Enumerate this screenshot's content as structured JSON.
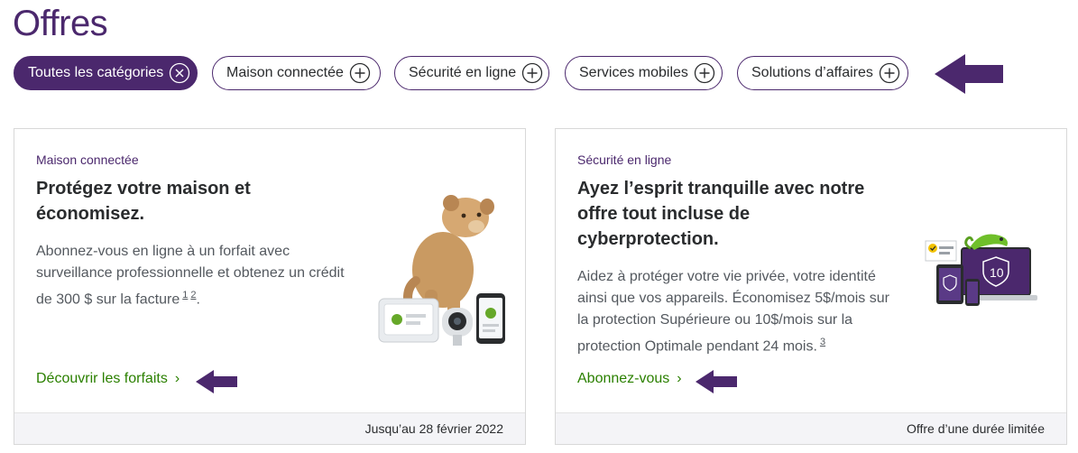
{
  "page": {
    "title": "Offres"
  },
  "filters": [
    {
      "label": "Toutes les catégories",
      "active": true,
      "icon": "close-circle-icon"
    },
    {
      "label": "Maison connectée",
      "active": false,
      "icon": "plus-circle-icon"
    },
    {
      "label": "Sécurité en ligne",
      "active": false,
      "icon": "plus-circle-icon"
    },
    {
      "label": "Services mobiles",
      "active": false,
      "icon": "plus-circle-icon"
    },
    {
      "label": "Solutions d’affaires",
      "active": false,
      "icon": "plus-circle-icon"
    }
  ],
  "cards": [
    {
      "category": "Maison connectée",
      "title_line1": "Protégez votre maison et",
      "title_line2": "économisez.",
      "text_line1": "Abonnez-vous en ligne à un forfait avec",
      "text_line2": "surveillance professionnelle et obtenez un crédit",
      "text_line3": "de 300 $ sur la facture",
      "footnote_a": "1",
      "footnote_b": "2",
      "text_end": ".",
      "link": "Découvrir les forfaits",
      "footer": "Jusqu’au 28 février 2022",
      "image": "lion-cub-smart-home-devices"
    },
    {
      "category": "Sécurité en ligne",
      "title_line1": "Ayez l’esprit tranquille avec notre",
      "title_line2": "offre tout incluse de",
      "title_line3": "cyberprotection.",
      "text_line1": "Aidez à protéger votre vie privée, votre identité",
      "text_line2": "ainsi que vos appareils. Économisez 5$/mois sur",
      "text_line3": "la protection Supérieure ou 10$/mois sur la",
      "text_line4": "protection Optimale pendant 24 mois.",
      "footnote": "3",
      "link": "Abonnez-vous",
      "footer": "Offre d’une durée limitée",
      "image": "chameleon-devices-security"
    }
  ],
  "colors": {
    "brand": "#4b286d",
    "link": "#2b8000",
    "arrow": "#4b286d"
  }
}
